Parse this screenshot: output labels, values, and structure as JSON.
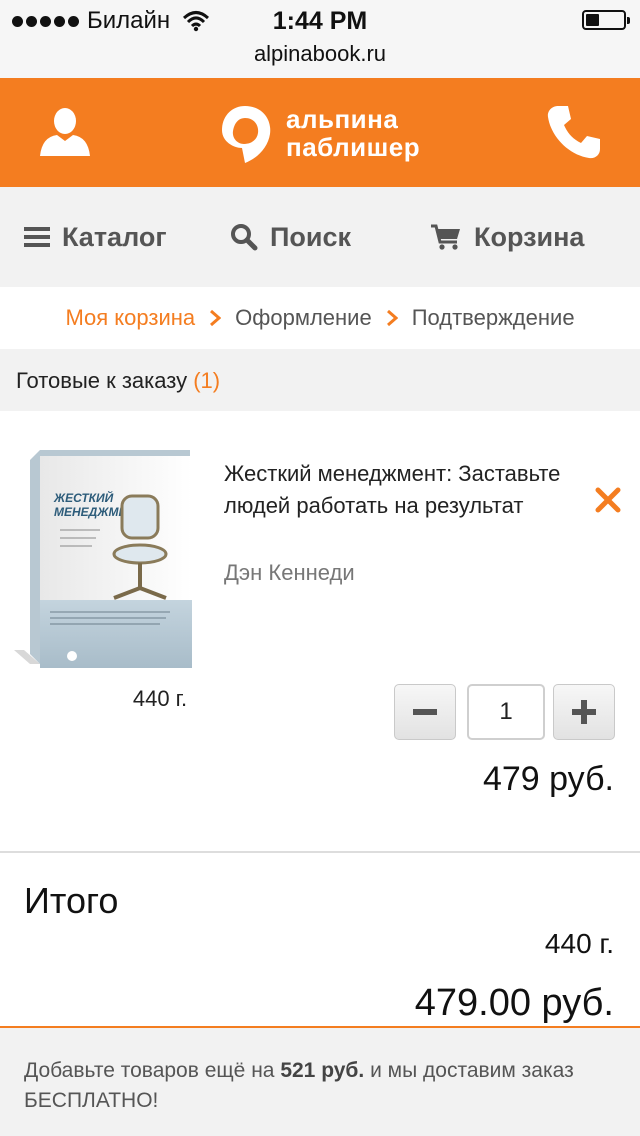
{
  "status_bar": {
    "carrier": "Билайн",
    "time": "1:44 PM",
    "battery_level": 0.35
  },
  "browser": {
    "url": "alpinabook.ru"
  },
  "header": {
    "logo_line1": "альпина",
    "logo_line2": "паблишер",
    "brand_color": "#f47d20"
  },
  "nav": {
    "catalog": "Каталог",
    "search": "Поиск",
    "cart": "Корзина"
  },
  "breadcrumbs": {
    "step1": "Моя корзина",
    "step2": "Оформление",
    "step3": "Подтверждение"
  },
  "section": {
    "label": "Готовые к заказу",
    "count": "(1)"
  },
  "item": {
    "title": "Жесткий менеджмент: Заставьте людей работать на результат",
    "author": "Дэн Кеннеди",
    "weight": "440 г.",
    "quantity": "1",
    "price": "479 руб.",
    "cover": {
      "title_line1": "ЖЕСТКИЙ",
      "title_line2": "МЕНЕДЖМЕНТ"
    }
  },
  "totals": {
    "label": "Итого",
    "weight": "440 г.",
    "sum": "479.00 руб."
  },
  "note": {
    "prefix": "Добавьте товаров ещё на",
    "amount": "521 руб.",
    "suffix": "и мы доставим заказ БЕСПЛАТНО!"
  }
}
